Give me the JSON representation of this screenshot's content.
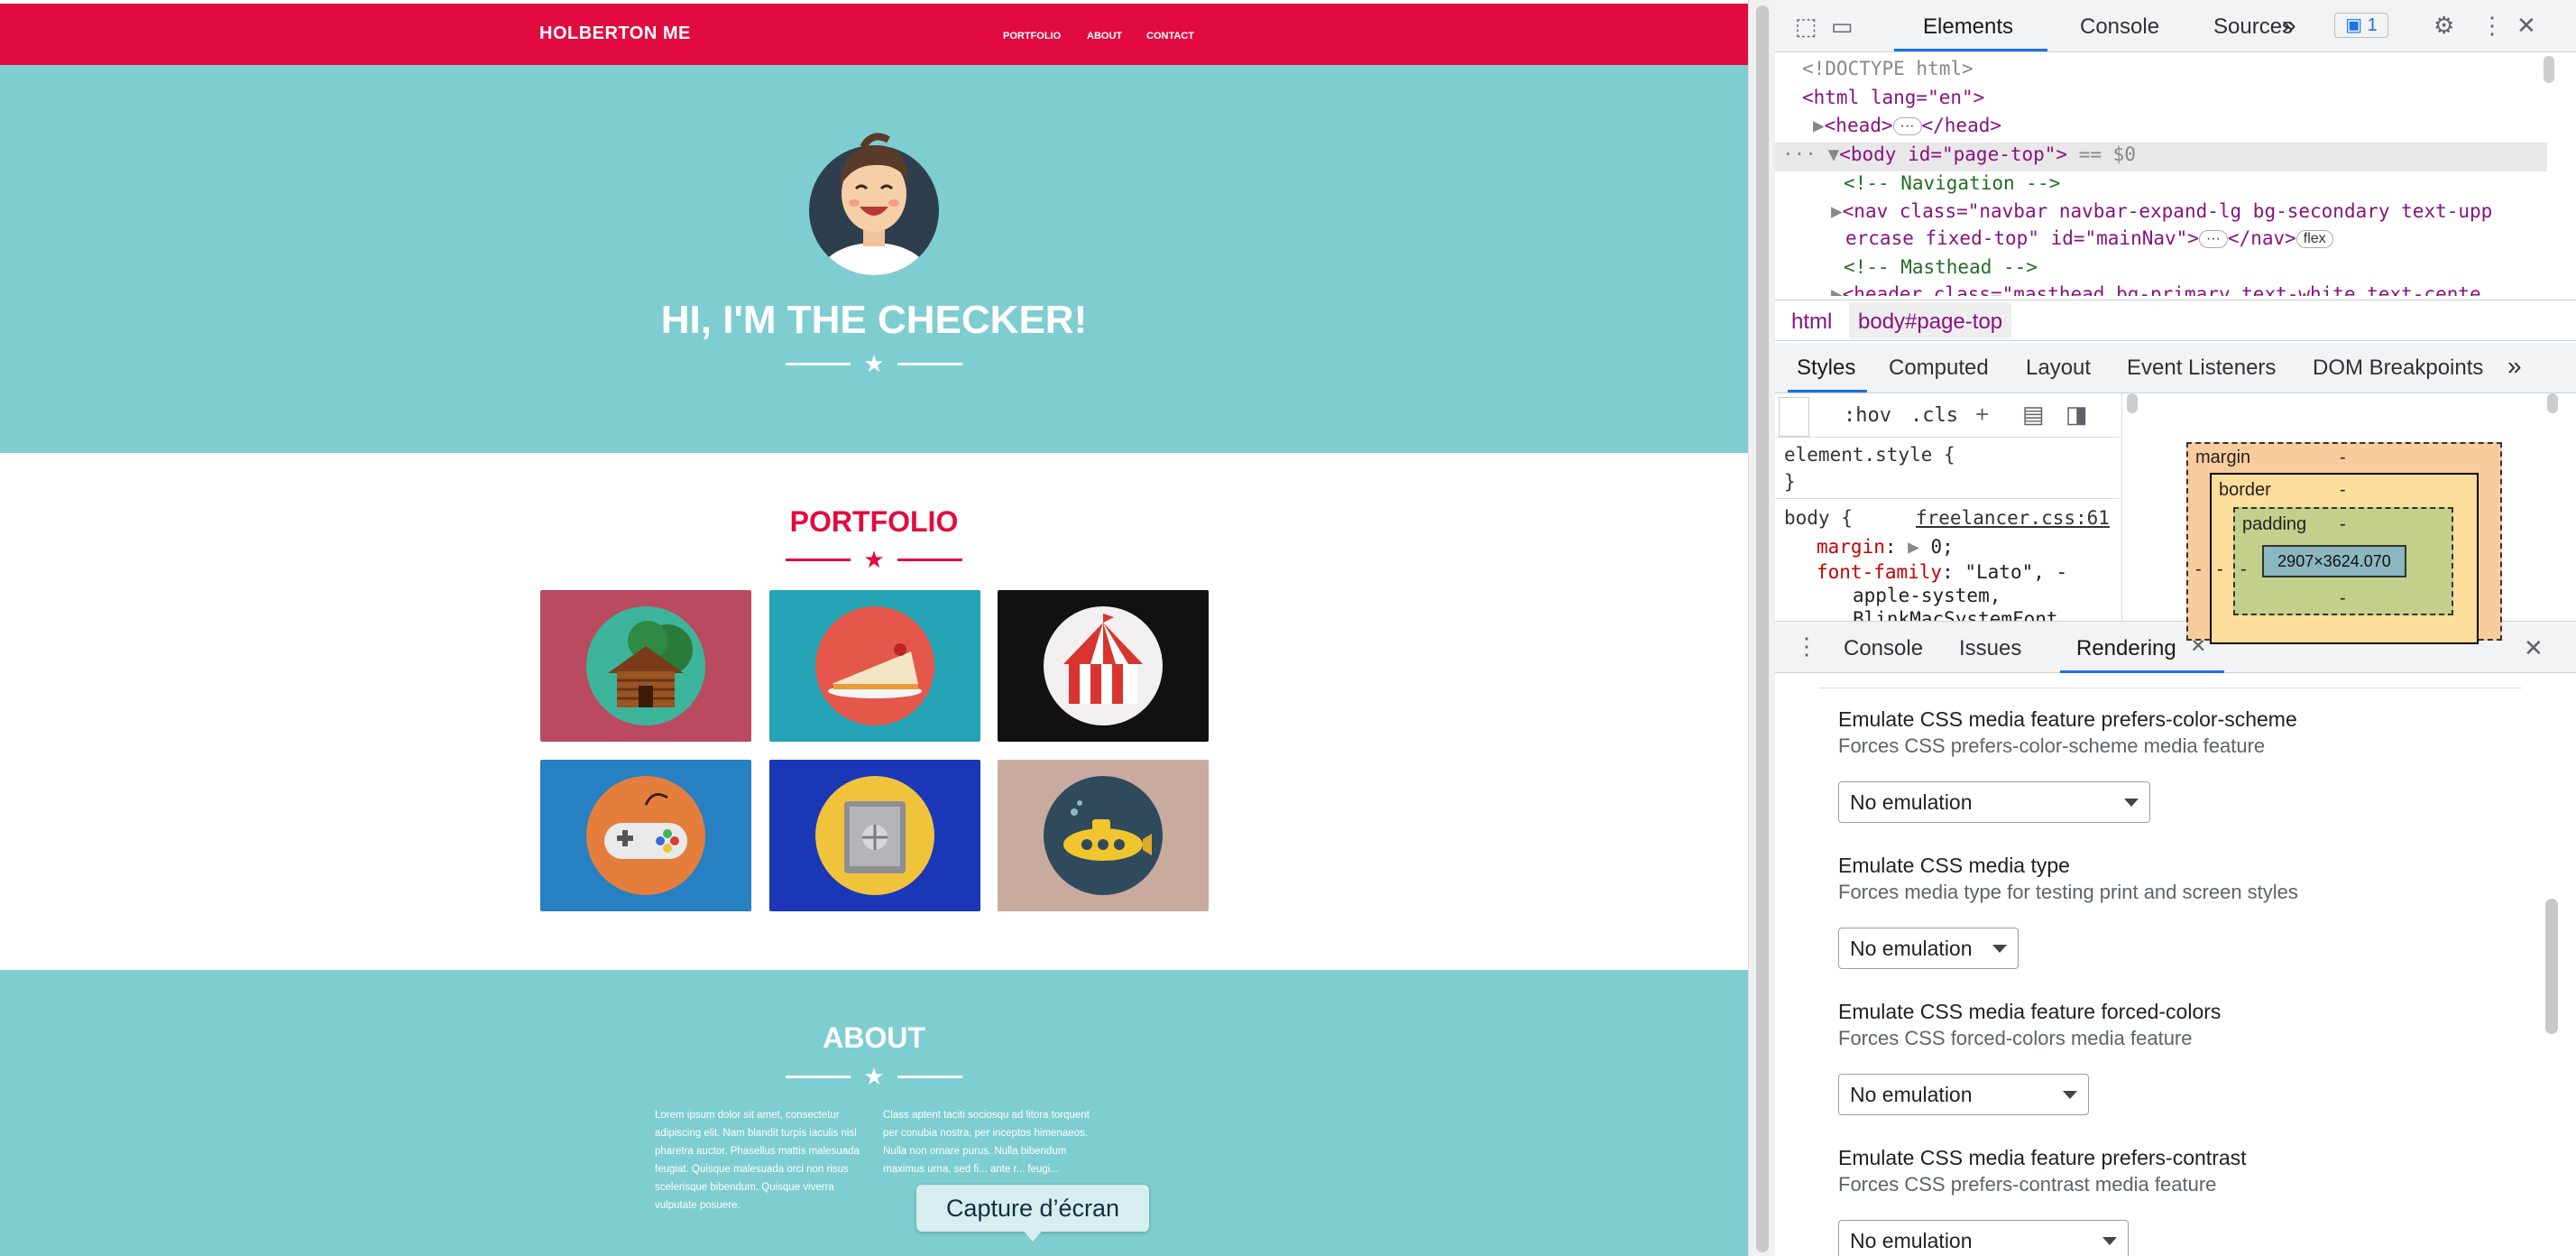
{
  "site": {
    "brand": "HOLBERTON ME",
    "nav": [
      "PORTFOLIO",
      "ABOUT",
      "CONTACT"
    ],
    "hero_title": "HI, I'M THE CHECKER!",
    "portfolio_title": "PORTFOLIO",
    "about_title": "ABOUT",
    "about_left": "Lorem ipsum dolor sit amet, consectetur adipiscing elit. Nam blandit turpis iaculis nisl pharetra auctor. Phasellus mattis malesuada feugiat. Quisque malesuada orci non risus scelerisque bibendum. Quisque viverra vulputate posuere.",
    "about_right": "Class aptent taciti sociosqu ad litora torquent per conubia nostra, per inceptos himenaeos. Nulla non ornare purus. Nulla bibendum maximus urna, sed fi... ante r... feugi...",
    "colors": {
      "primary": "#e20b3f",
      "secondary": "#7ecdd0"
    },
    "portfolio_items": [
      {
        "icon": "cabin-icon",
        "bg": "#b94a60"
      },
      {
        "icon": "cake-icon",
        "bg": "#24a3b4"
      },
      {
        "icon": "circus-tent-icon",
        "bg": "#111111"
      },
      {
        "icon": "game-controller-icon",
        "bg": "#2680c2"
      },
      {
        "icon": "safe-icon",
        "bg": "#1a37b8"
      },
      {
        "icon": "submarine-icon",
        "bg": "#c8ab9e"
      }
    ]
  },
  "toast": "Capture d’écran",
  "devtools": {
    "tabs": [
      "Elements",
      "Console",
      "Sources"
    ],
    "more": "»",
    "badge": "1",
    "dom": {
      "doctype": "<!DOCTYPE html>",
      "html": "<html lang=\"en\">",
      "head": "<head>",
      "head_close": "</head>",
      "body_tag": "<body id=\"page-top\">",
      "selected_suffix": "== $0",
      "comment_nav": "<!-- Navigation -->",
      "nav_line1": "<nav class=\"navbar navbar-expand-lg bg-secondary text-upp",
      "nav_line2": "ercase fixed-top\" id=\"mainNav\">",
      "nav_close": "</nav>",
      "flex": "flex",
      "comment_masthead": "<!-- Masthead -->",
      "header_line": "<header class=\"masthead bg-primary text-white text-cente"
    },
    "breadcrumb": [
      "html",
      "body#page-top"
    ],
    "style_tabs": [
      "Styles",
      "Computed",
      "Layout",
      "Event Listeners",
      "DOM Breakpoints"
    ],
    "styles_toolbar": {
      "hov": ":hov",
      "cls": ".cls"
    },
    "rules": {
      "element_style": "element.style {",
      "close": "}",
      "body_selector": "body {",
      "source": "freelancer.css:61",
      "margin_prop": "margin",
      "margin_val": "0;",
      "font_prop": "font-family",
      "font_val": "\"Lato\", -",
      "font_val2": "apple-system,",
      "font_val3": "BlinkMacSystemFont"
    },
    "box_model": {
      "margin": "margin",
      "border": "border",
      "padding": "padding",
      "content": "2907×3624.070",
      "dash": "-"
    },
    "drawer_tabs": [
      "Console",
      "Issues",
      "Rendering"
    ],
    "rendering": [
      {
        "title": "Emulate CSS media feature prefers-color-scheme",
        "sub": "Forces CSS prefers-color-scheme media feature",
        "value": "No emulation"
      },
      {
        "title": "Emulate CSS media type",
        "sub": "Forces media type for testing print and screen styles",
        "value": "No emulation"
      },
      {
        "title": "Emulate CSS media feature forced-colors",
        "sub": "Forces CSS forced-colors media feature",
        "value": "No emulation"
      },
      {
        "title": "Emulate CSS media feature prefers-contrast",
        "sub": "Forces CSS prefers-contrast media feature",
        "value": "No emulation"
      }
    ]
  }
}
